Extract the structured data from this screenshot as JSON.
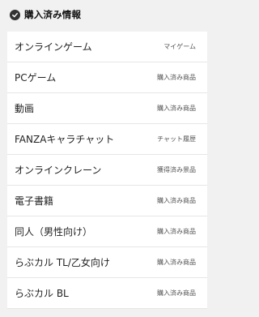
{
  "header": {
    "icon": "check-circle-icon",
    "title": "購入済み情報"
  },
  "menu": {
    "items": [
      {
        "label": "オンラインゲーム",
        "sub": "マイゲーム"
      },
      {
        "label": "PCゲーム",
        "sub": "購入済み商品"
      },
      {
        "label": "動画",
        "sub": "購入済み商品"
      },
      {
        "label": "FANZAキャラチャット",
        "sub": "チャット履歴"
      },
      {
        "label": "オンラインクレーン",
        "sub": "獲得済み景品"
      },
      {
        "label": "電子書籍",
        "sub": "購入済み商品"
      },
      {
        "label": "同人（男性向け）",
        "sub": "購入済み商品"
      },
      {
        "label": "らぶカル TL/乙女向け",
        "sub": "購入済み商品"
      },
      {
        "label": "らぶカル BL",
        "sub": "購入済み商品"
      }
    ]
  }
}
